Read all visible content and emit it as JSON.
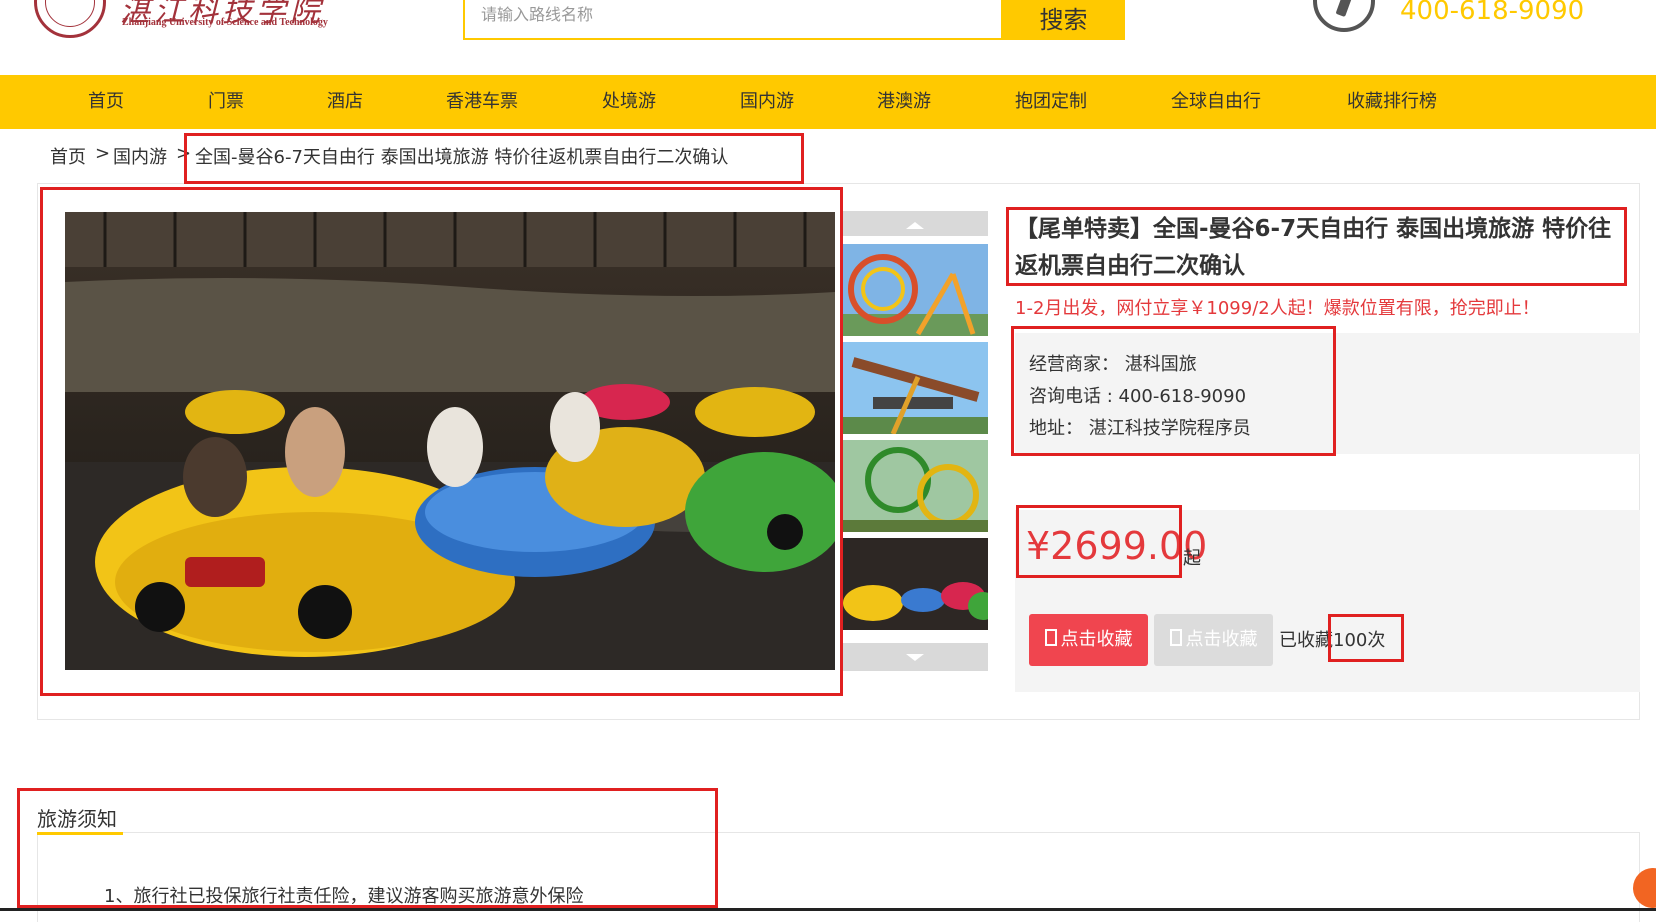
{
  "header": {
    "logo_cn": "湛江科技学院",
    "logo_en": "Zhanjiang University of Science and Technology",
    "search_placeholder": "请输入路线名称",
    "search_button": "搜索",
    "phone": "400-618-9090"
  },
  "nav": {
    "items": [
      "首页",
      "门票",
      "酒店",
      "香港车票",
      "处境游",
      "国内游",
      "港澳游",
      "抱团定制",
      "全球自由行",
      "收藏排行榜"
    ]
  },
  "breadcrumb": {
    "home": "首页",
    "sep1": ">",
    "category": "国内游",
    "sep2": ">",
    "current": "全国-曼谷6-7天自由行 泰国出境旅游 特价往返机票自由行二次确认"
  },
  "product": {
    "title": "【尾单特卖】全国-曼谷6-7天自由行 泰国出境旅游 特价往返机票自由行二次确认",
    "promo": "1-2月出发，网付立享￥1099/2人起！爆款位置有限，抢完即止！",
    "merchant": "经营商家： 湛科国旅",
    "phone": "咨询电话 : 400-618-9090",
    "address": "地址： 湛江科技学院程序员",
    "price": "¥2699.00",
    "price_suffix": "起",
    "favorite_button": "点击收藏",
    "favorite_button_disabled": "点击收藏",
    "favorite_count": "已收藏100次"
  },
  "notice": {
    "title": "旅游须知",
    "item_1": "1、旅行社已投保旅行社责任险，建议游客购买旅游意外保险"
  },
  "colors": {
    "brand_yellow": "#ffc900",
    "price_red": "#e4393c",
    "annotation_red": "#e02020"
  }
}
